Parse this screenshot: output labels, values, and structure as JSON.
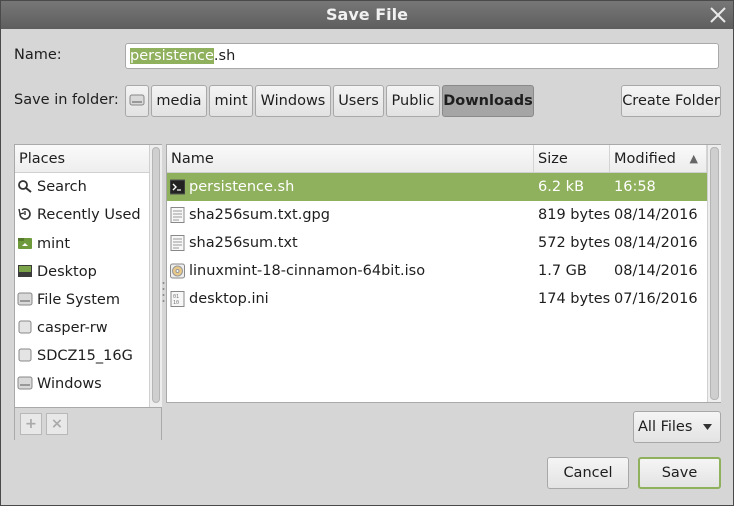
{
  "window": {
    "title": "Save File"
  },
  "name_field": {
    "label": "Name:",
    "selected_part": "persistence",
    "rest_part": ".sh"
  },
  "folder": {
    "label": "Save in folder:",
    "path": [
      "media",
      "mint",
      "Windows",
      "Users",
      "Public",
      "Downloads"
    ],
    "create_folder_label": "Create Folder"
  },
  "places": {
    "header": "Places",
    "items": [
      {
        "label": "Search",
        "icon": "search-icon"
      },
      {
        "label": "Recently Used",
        "icon": "recent-icon"
      },
      {
        "label": "mint",
        "icon": "home-folder-icon"
      },
      {
        "label": "Desktop",
        "icon": "desktop-icon"
      },
      {
        "label": "File System",
        "icon": "drive-icon"
      },
      {
        "label": "casper-rw",
        "icon": "removable-drive-icon"
      },
      {
        "label": "SDCZ15_16G",
        "icon": "removable-drive-icon"
      },
      {
        "label": "Windows",
        "icon": "drive-icon"
      }
    ],
    "add_label": "+",
    "remove_label": "×"
  },
  "files": {
    "columns": {
      "name": "Name",
      "size": "Size",
      "modified": "Modified",
      "sort_arrow": "▲"
    },
    "rows": [
      {
        "name": "persistence.sh",
        "size": "6.2 kB",
        "modified": "16:58",
        "icon": "terminal-script-icon",
        "selected": true
      },
      {
        "name": "sha256sum.txt.gpg",
        "size": "819 bytes",
        "modified": "08/14/2016",
        "icon": "text-file-icon"
      },
      {
        "name": "sha256sum.txt",
        "size": "572 bytes",
        "modified": "08/14/2016",
        "icon": "text-file-icon"
      },
      {
        "name": "linuxmint-18-cinnamon-64bit.iso",
        "size": "1.7 GB",
        "modified": "08/14/2016",
        "icon": "disc-image-icon"
      },
      {
        "name": "desktop.ini",
        "size": "174 bytes",
        "modified": "07/16/2016",
        "icon": "binary-file-icon"
      }
    ]
  },
  "filter": {
    "value": "All Files"
  },
  "buttons": {
    "cancel": "Cancel",
    "save": "Save"
  },
  "colors": {
    "accent": "#8fb05c",
    "titlebar": "#666666",
    "background": "#d6d6d6"
  }
}
